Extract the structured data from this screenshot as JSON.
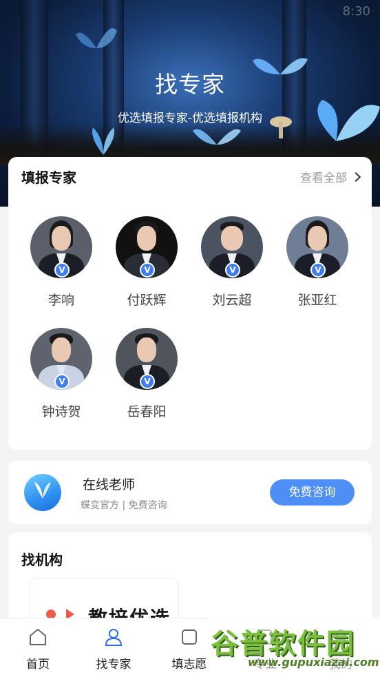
{
  "hero": {
    "title": "找专家",
    "subtitle": "优选填报专家-优选填报机构",
    "status_time": "8:30"
  },
  "experts_section": {
    "title": "填报专家",
    "see_all_label": "查看全部",
    "verify_badge": "V",
    "experts": [
      {
        "name": "李响"
      },
      {
        "name": "付跃辉"
      },
      {
        "name": "刘云超"
      },
      {
        "name": "张亚红"
      },
      {
        "name": "钟诗贺"
      },
      {
        "name": "岳春阳"
      }
    ]
  },
  "online_teacher": {
    "title": "在线老师",
    "subtitle": "蝶变官方 | 免费咨询",
    "button_label": "免费咨询"
  },
  "org_section": {
    "title": "找机构",
    "org_name": "教培优选"
  },
  "tabbar": {
    "tabs": [
      {
        "label": "首页",
        "icon": "home-icon"
      },
      {
        "label": "找专家",
        "icon": "expert-icon"
      },
      {
        "label": "填志愿",
        "icon": "form-icon"
      },
      {
        "label": "专业",
        "icon": "book-icon"
      },
      {
        "label": "我的",
        "icon": "user-icon"
      }
    ]
  },
  "watermark": {
    "main": "谷普软件园",
    "url": "www.gupuxiazai.com"
  },
  "colors": {
    "accent": "#4e8ef7",
    "verify": "#3d7ff0",
    "watermark_green": "#7bbf3e"
  }
}
